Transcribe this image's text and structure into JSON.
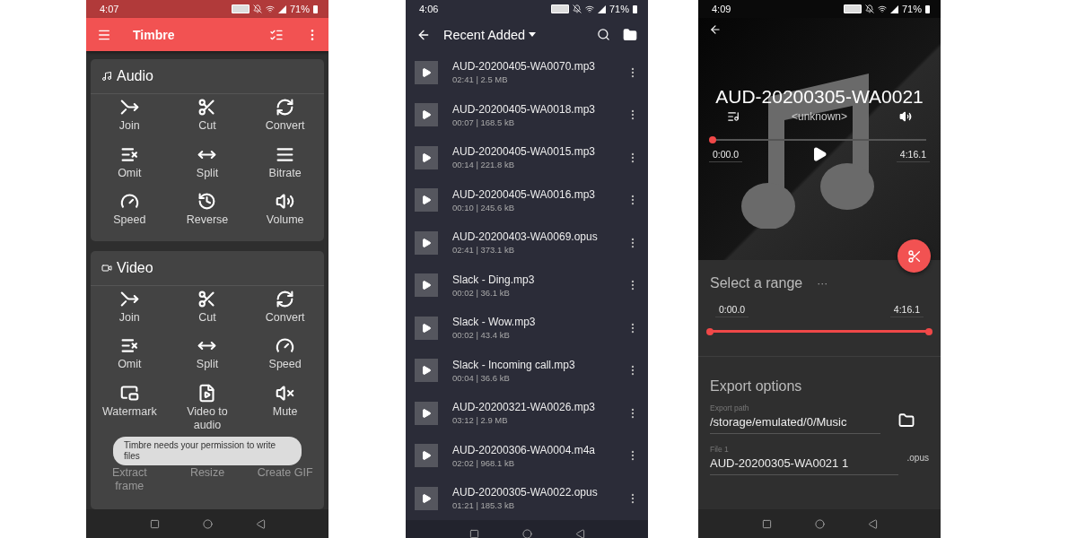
{
  "tools_screen": {
    "status_bar": {
      "time": "4:07",
      "battery": "71%"
    },
    "app_bar": {
      "title": "Timbre"
    },
    "cards": [
      {
        "title": "Audio",
        "kind": "audio",
        "tools": [
          {
            "label": "Join",
            "dimmed": false
          },
          {
            "label": "Cut",
            "dimmed": false
          },
          {
            "label": "Convert",
            "dimmed": false
          },
          {
            "label": "Omit",
            "dimmed": false
          },
          {
            "label": "Split",
            "dimmed": false
          },
          {
            "label": "Bitrate",
            "dimmed": false
          },
          {
            "label": "Speed",
            "dimmed": false
          },
          {
            "label": "Reverse",
            "dimmed": false
          },
          {
            "label": "Volume",
            "dimmed": false
          }
        ]
      },
      {
        "title": "Video",
        "kind": "video",
        "tools": [
          {
            "label": "Join",
            "dimmed": false
          },
          {
            "label": "Cut",
            "dimmed": false
          },
          {
            "label": "Convert",
            "dimmed": false
          },
          {
            "label": "Omit",
            "dimmed": false
          },
          {
            "label": "Split",
            "dimmed": false
          },
          {
            "label": "Speed",
            "dimmed": false
          },
          {
            "label": "Watermark",
            "dimmed": false
          },
          {
            "label": "Video to audio",
            "dimmed": false
          },
          {
            "label": "Mute",
            "dimmed": false
          },
          {
            "label": "Extract frame",
            "dimmed": true
          },
          {
            "label": "Resize",
            "dimmed": true
          },
          {
            "label": "Create GIF",
            "dimmed": true
          }
        ]
      }
    ],
    "toast": "Timbre needs your permission to write files"
  },
  "file_list_screen": {
    "status_bar": {
      "time": "4:06",
      "battery": "71%"
    },
    "header": {
      "title": "Recent Added"
    },
    "files": [
      {
        "name": "AUD-20200405-WA0070.mp3",
        "meta": "02:41 | 2.5 MB"
      },
      {
        "name": "AUD-20200405-WA0018.mp3",
        "meta": "00:07 | 168.5 kB"
      },
      {
        "name": "AUD-20200405-WA0015.mp3",
        "meta": "00:14 | 221.8 kB"
      },
      {
        "name": "AUD-20200405-WA0016.mp3",
        "meta": "00:10 | 245.6 kB"
      },
      {
        "name": "AUD-20200403-WA0069.opus",
        "meta": "02:41 | 373.1 kB"
      },
      {
        "name": "Slack - Ding.mp3",
        "meta": "00:02 | 36.1 kB"
      },
      {
        "name": "Slack - Wow.mp3",
        "meta": "00:02 | 43.4 kB"
      },
      {
        "name": "Slack - Incoming call.mp3",
        "meta": "00:04 | 36.6 kB"
      },
      {
        "name": "AUD-20200321-WA0026.mp3",
        "meta": "03:12 | 2.9 MB"
      },
      {
        "name": "AUD-20200306-WA0004.m4a",
        "meta": "02:02 | 968.1 kB"
      },
      {
        "name": "AUD-20200305-WA0022.opus",
        "meta": "01:21 | 185.3 kB"
      }
    ]
  },
  "editor_screen": {
    "status_bar": {
      "time": "4:09",
      "battery": "71%"
    },
    "player": {
      "title": "AUD-20200305-WA0021",
      "artist": "<unknown>",
      "level": 0,
      "position": "0:00.0",
      "duration": "4:16.1"
    },
    "range": {
      "title": "Select a range",
      "more": "···",
      "start": "0:00.0",
      "end": "4:16.1",
      "thumbs": [
        {
          "level": 0
        },
        {
          "level": 1
        }
      ]
    },
    "export": {
      "title": "Export options",
      "path_label": "Export path",
      "path": "/storage/emulated/0/Music",
      "file_label": "File 1",
      "file_name": "AUD-20200305-WA0021 1",
      "extension": ".opus"
    }
  }
}
